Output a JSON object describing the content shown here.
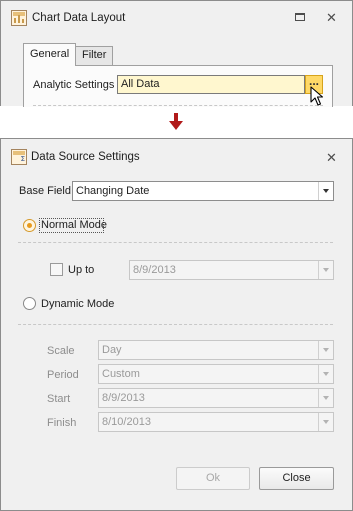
{
  "layout_window": {
    "title": "Chart Data Layout",
    "tabs": [
      {
        "label": "General",
        "active": true
      },
      {
        "label": "Filter",
        "active": false
      }
    ],
    "analytic_settings_label": "Analytic Settings",
    "analytic_settings_value": "All Data",
    "ellipsis_button": "..."
  },
  "dialog": {
    "title": "Data Source Settings",
    "base_field_label": "Base Field",
    "base_field_value": "Changing Date",
    "normal_mode_label": "Normal Mode",
    "normal_mode_selected": true,
    "up_to_label": "Up to",
    "up_to_checked": false,
    "up_to_value": "8/9/2013",
    "dynamic_mode_label": "Dynamic Mode",
    "dynamic_mode_selected": false,
    "scale_label": "Scale",
    "scale_value": "Day",
    "period_label": "Period",
    "period_value": "Custom",
    "start_label": "Start",
    "start_value": "8/9/2013",
    "finish_label": "Finish",
    "finish_value": "8/10/2013",
    "ok_label": "Ok",
    "close_label": "Close"
  },
  "icons": {
    "app": "chart-layout-icon",
    "datasource": "data-source-icon",
    "arrow": "down-arrow-icon",
    "restore": "restore-icon",
    "close": "close-icon",
    "cursor": "mouse-cursor-icon"
  },
  "colors": {
    "accent_input": "#fff7cf",
    "ellipsis_highlight": "#ffd967",
    "radio_selected": "#e79a1e",
    "arrow": "#b11a1a"
  }
}
